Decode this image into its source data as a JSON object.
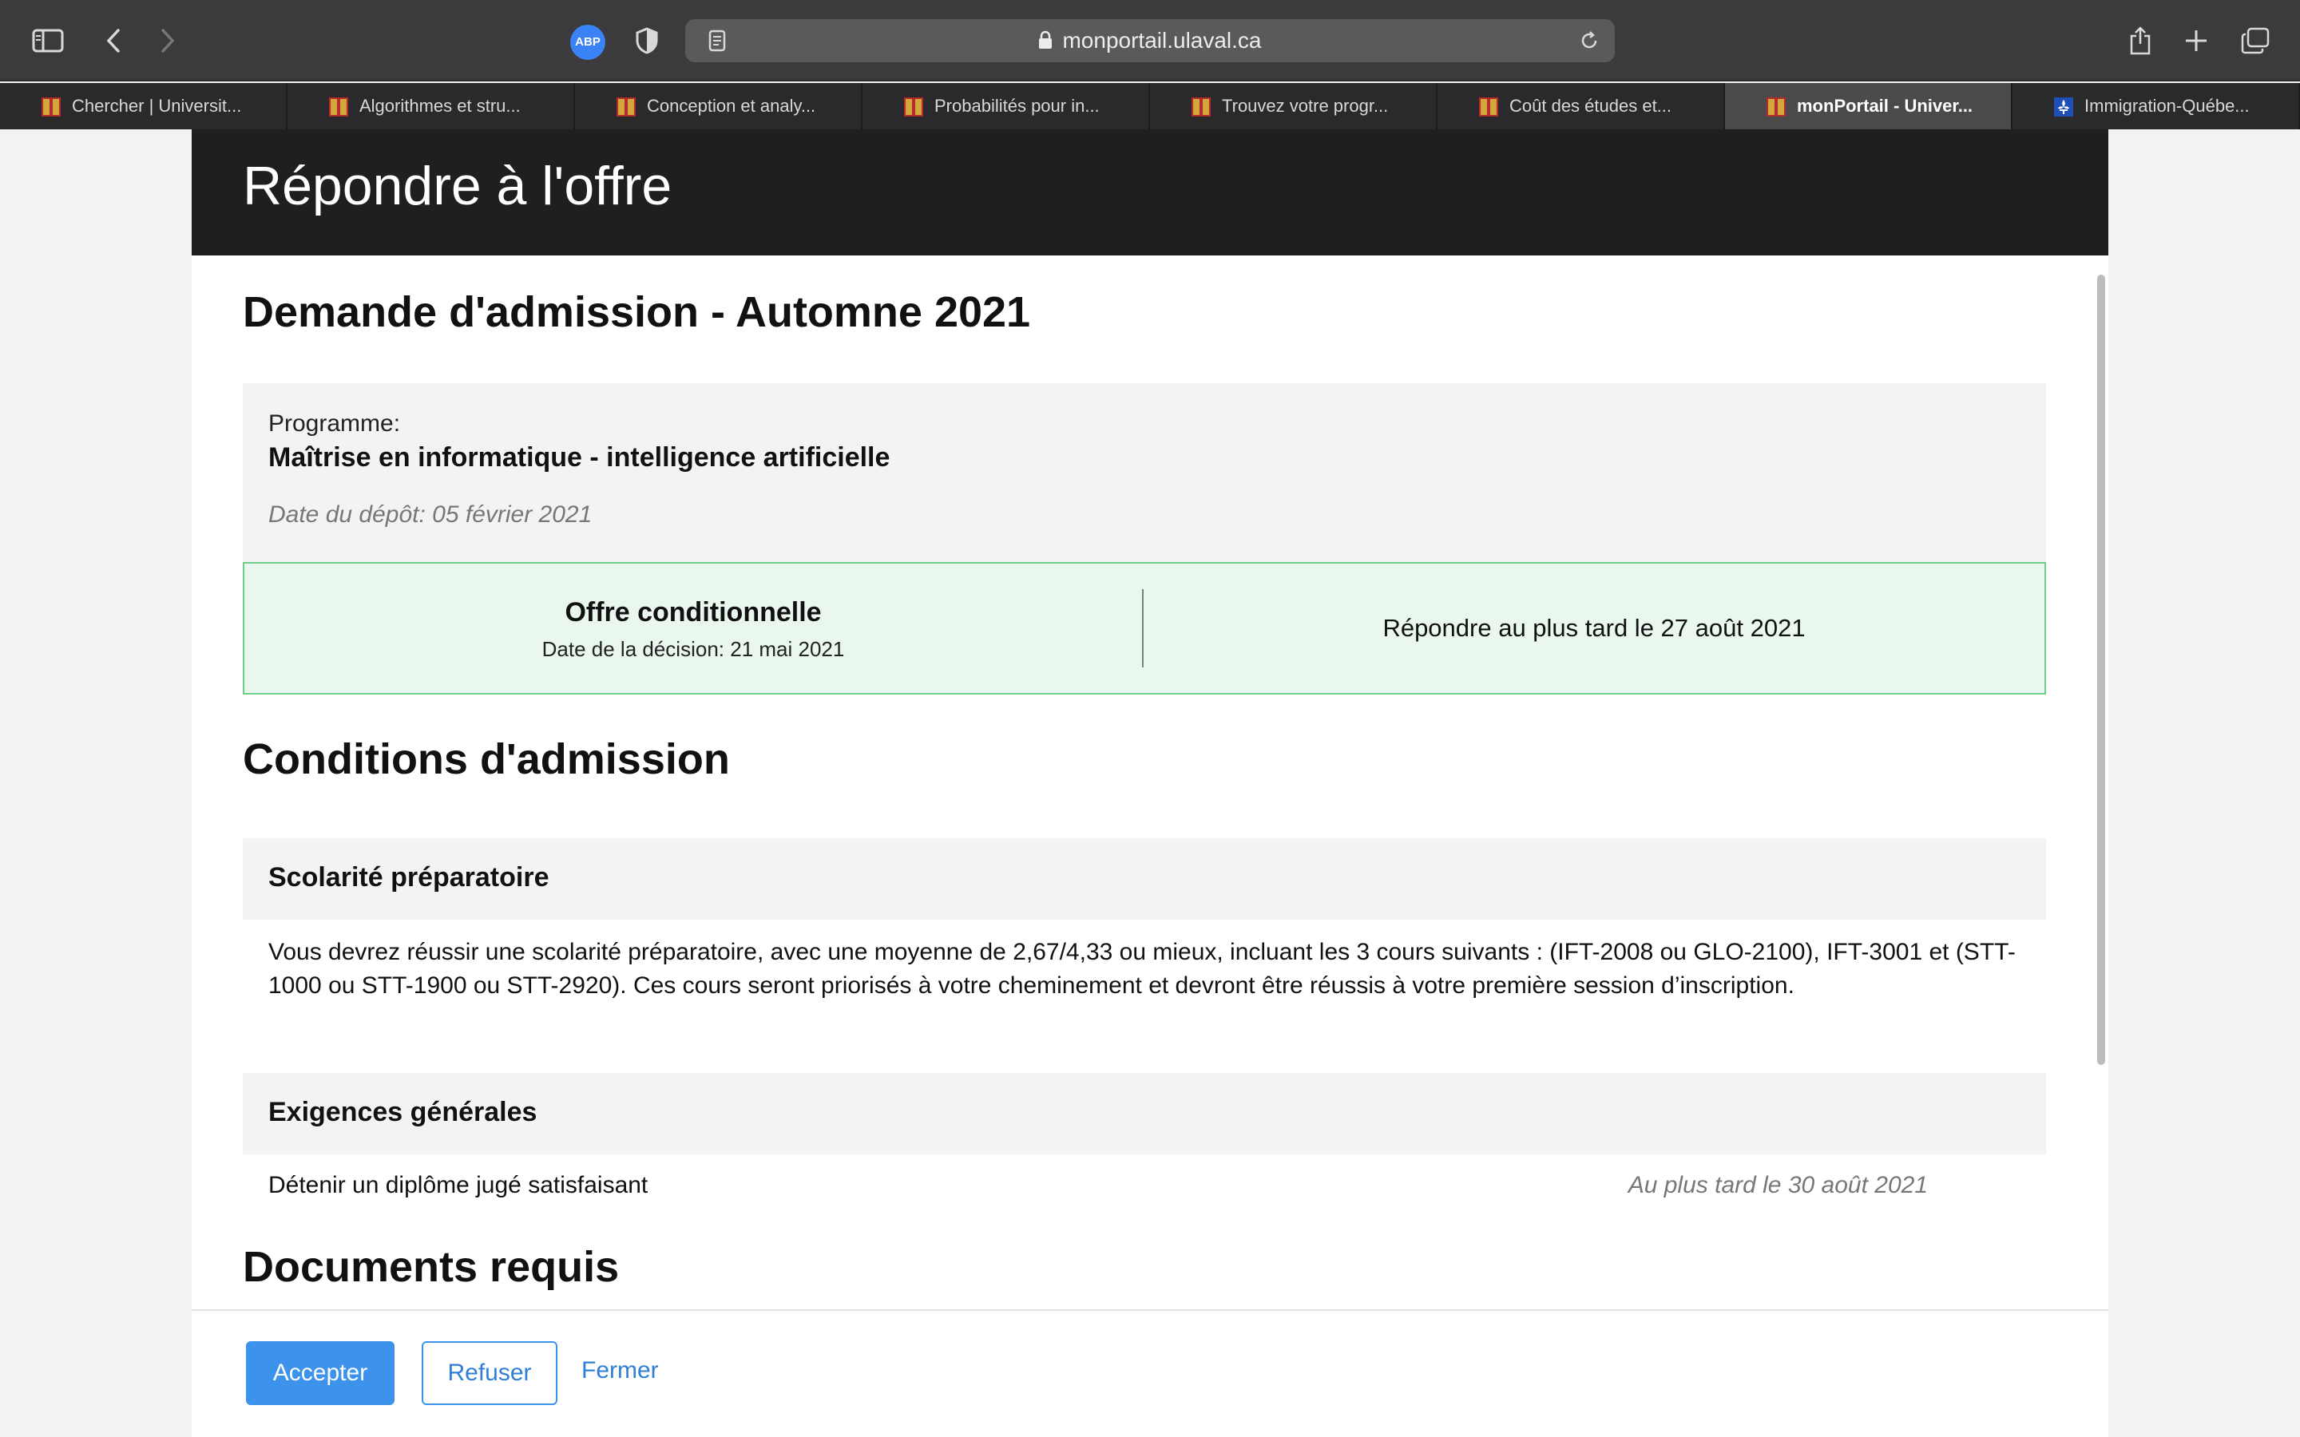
{
  "browser": {
    "url": "monportail.ulaval.ca",
    "abp_label": "ABP",
    "tabs": [
      {
        "label": "Chercher | Universit...",
        "favicon": "ulaval-icon",
        "active": false
      },
      {
        "label": "Algorithmes et stru...",
        "favicon": "ulaval-icon",
        "active": false
      },
      {
        "label": "Conception et analy...",
        "favicon": "ulaval-icon",
        "active": false
      },
      {
        "label": "Probabilités pour in...",
        "favicon": "ulaval-icon",
        "active": false
      },
      {
        "label": "Trouvez votre progr...",
        "favicon": "ulaval-icon",
        "active": false
      },
      {
        "label": "Coût des études et...",
        "favicon": "ulaval-icon",
        "active": false
      },
      {
        "label": "monPortail - Univer...",
        "favicon": "ulaval-icon",
        "active": true
      },
      {
        "label": "Immigration-Québe...",
        "favicon": "quebec-fleur-icon",
        "active": false
      }
    ]
  },
  "modal": {
    "title": "Répondre à l'offre",
    "application": {
      "heading": "Demande d'admission - Automne 2021",
      "program_label": "Programme:",
      "program_name": "Maîtrise en informatique - intelligence artificielle",
      "submission_date": "Date du dépôt: 05 février 2021"
    },
    "offer": {
      "title": "Offre conditionnelle",
      "decision_date": "Date de la décision: 21 mai 2021",
      "deadline": "Répondre au plus tard le 27 août 2021"
    },
    "conditions": {
      "heading": "Conditions d'admission",
      "prep_title": "Scolarité préparatoire",
      "prep_text": "Vous devrez réussir une scolarité préparatoire, avec une moyenne de 2,67/4,33 ou mieux, incluant les 3 cours suivants : (IFT-2008 ou GLO-2100), IFT-3001 et (STT-1000 ou STT-1900 ou STT-2920). Ces cours seront priorisés à votre cheminement et devront être réussis à votre première session d’inscription.",
      "general_title": "Exigences générales",
      "general_requirement": "Détenir un diplôme jugé satisfaisant",
      "general_deadline": "Au plus tard le 30 août 2021"
    },
    "documents_heading": "Documents requis",
    "actions": {
      "accept": "Accepter",
      "refuse": "Refuser",
      "close": "Fermer"
    }
  },
  "colors": {
    "accent": "#3d93ec",
    "header_bg": "#1f1f1f",
    "offer_bg": "#eaf7ee",
    "offer_border": "#6ccf8c"
  }
}
